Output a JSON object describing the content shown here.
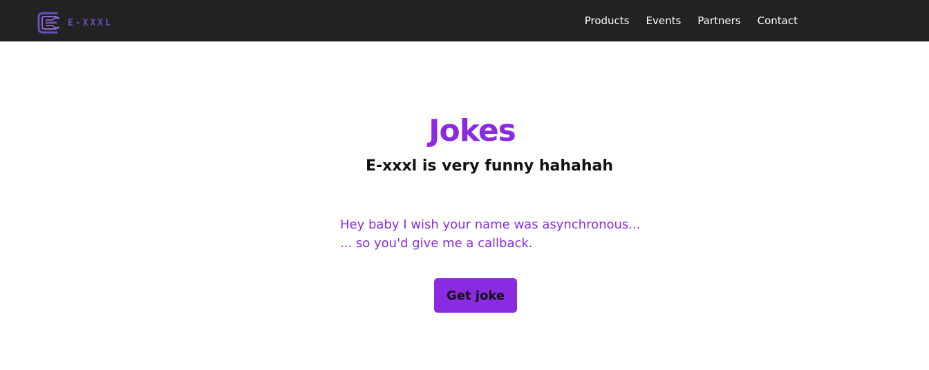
{
  "header": {
    "logo_text": "E-XXXL",
    "nav": [
      "Products",
      "Events",
      "Partners",
      "Contact"
    ]
  },
  "main": {
    "title": "Jokes",
    "subtitle": "E-xxxl is very funny hahahah",
    "joke_setup": "Hey baby I wish your name was asynchronous...",
    "joke_punchline": "... so you'd give me a callback.",
    "button_label": "Get joke"
  },
  "colors": {
    "navbar_bg": "#222222",
    "accent": "#8a2be2",
    "nav_text": "#ffffff",
    "heading_text": "#111111"
  },
  "icons": {
    "logo": "circuit-e-logo-icon"
  }
}
